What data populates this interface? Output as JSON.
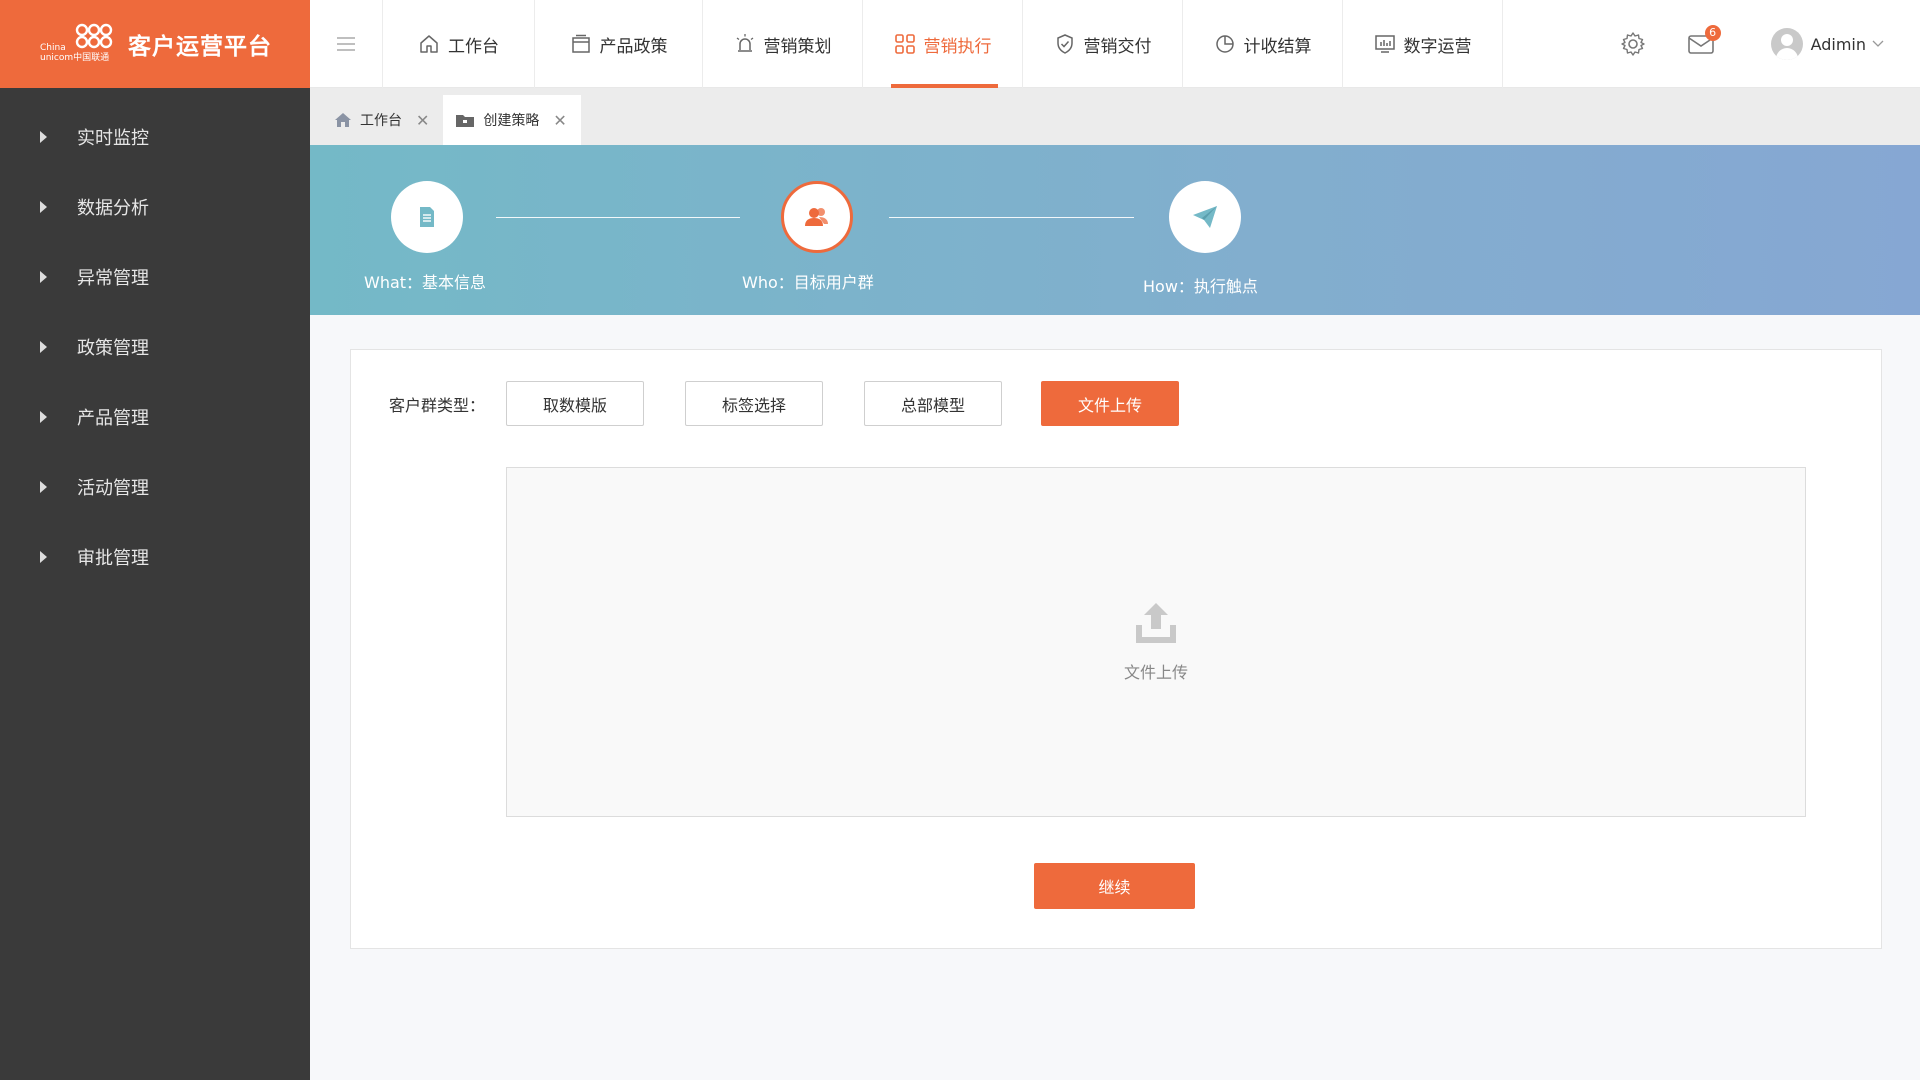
{
  "app": {
    "logo_small_top": "China",
    "logo_small_bottom": "unicom中国联通",
    "title": "客户运营平台"
  },
  "sidebar": {
    "items": [
      {
        "label": "实时监控"
      },
      {
        "label": "数据分析"
      },
      {
        "label": "异常管理"
      },
      {
        "label": "政策管理"
      },
      {
        "label": "产品管理"
      },
      {
        "label": "活动管理"
      },
      {
        "label": "审批管理"
      }
    ]
  },
  "topnav": {
    "tabs": [
      {
        "label": "工作台",
        "icon": "home-icon"
      },
      {
        "label": "产品政策",
        "icon": "box-icon"
      },
      {
        "label": "营销策划",
        "icon": "lamp-icon"
      },
      {
        "label": "营销执行",
        "icon": "grid-icon"
      },
      {
        "label": "营销交付",
        "icon": "shield-icon"
      },
      {
        "label": "计收结算",
        "icon": "pie-icon"
      },
      {
        "label": "数字运营",
        "icon": "monitor-icon"
      }
    ],
    "active_tab": "营销执行",
    "mail_badge": "6",
    "user_name": "Adimin"
  },
  "page_tabs": [
    {
      "label": "工作台",
      "icon": "home-icon"
    },
    {
      "label": "创建策略",
      "icon": "folder-icon"
    }
  ],
  "steps": [
    {
      "label": "What：基本信息",
      "icon": "document-icon"
    },
    {
      "label": "Who：目标用户群",
      "icon": "users-icon"
    },
    {
      "label": "How：执行触点",
      "icon": "paper-plane-icon"
    }
  ],
  "form": {
    "type_label": "客户群类型：",
    "type_options": [
      "取数模版",
      "标签选择",
      "总部模型",
      "文件上传"
    ],
    "selected_type": "文件上传",
    "upload_text": "文件上传",
    "continue_label": "继续"
  },
  "colors": {
    "accent": "#ee6a3c",
    "sidebar_bg": "#3a3a3a"
  }
}
